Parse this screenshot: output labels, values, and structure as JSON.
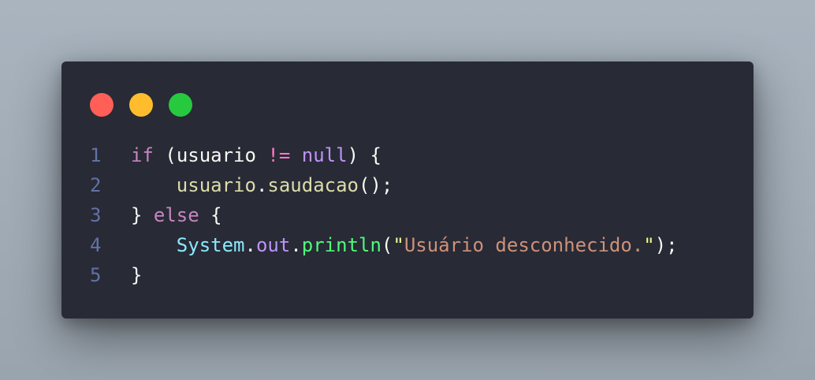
{
  "window": {
    "controls": [
      {
        "name": "close",
        "color": "#ff5f56"
      },
      {
        "name": "minimize",
        "color": "#ffbd2e"
      },
      {
        "name": "maximize",
        "color": "#27c93f"
      }
    ]
  },
  "colors": {
    "keyword": "#c586c0",
    "operator": "#ff79c6",
    "null": "#bd93f9",
    "default": "#f8f8f2",
    "method": "#dcdcaa",
    "class": "#8be9fd",
    "field": "#bd93f9",
    "call": "#50fa7b",
    "string": "#ce9178",
    "quote": "#f1fa8c",
    "line_number": "#6272a4"
  },
  "code": {
    "line_numbers": [
      "1",
      "2",
      "3",
      "4",
      "5"
    ],
    "lines": [
      {
        "tokens": [
          {
            "text": "if",
            "kind": "keyword"
          },
          {
            "text": " (",
            "kind": "default"
          },
          {
            "text": "usuario",
            "kind": "default"
          },
          {
            "text": " ",
            "kind": "default"
          },
          {
            "text": "!=",
            "kind": "operator"
          },
          {
            "text": " ",
            "kind": "default"
          },
          {
            "text": "null",
            "kind": "null"
          },
          {
            "text": ") {",
            "kind": "default"
          }
        ]
      },
      {
        "tokens": [
          {
            "text": "    ",
            "kind": "default"
          },
          {
            "text": "usuario",
            "kind": "method"
          },
          {
            "text": ".",
            "kind": "default"
          },
          {
            "text": "saudacao",
            "kind": "method"
          },
          {
            "text": "();",
            "kind": "default"
          }
        ]
      },
      {
        "tokens": [
          {
            "text": "} ",
            "kind": "default"
          },
          {
            "text": "else",
            "kind": "keyword"
          },
          {
            "text": " {",
            "kind": "default"
          }
        ]
      },
      {
        "tokens": [
          {
            "text": "    ",
            "kind": "default"
          },
          {
            "text": "System",
            "kind": "class"
          },
          {
            "text": ".",
            "kind": "default"
          },
          {
            "text": "out",
            "kind": "field"
          },
          {
            "text": ".",
            "kind": "default"
          },
          {
            "text": "println",
            "kind": "call"
          },
          {
            "text": "(",
            "kind": "default"
          },
          {
            "text": "\"",
            "kind": "quote"
          },
          {
            "text": "Usuário desconhecido.",
            "kind": "string"
          },
          {
            "text": "\"",
            "kind": "quote"
          },
          {
            "text": ");",
            "kind": "default"
          }
        ]
      },
      {
        "tokens": [
          {
            "text": "}",
            "kind": "default"
          }
        ]
      }
    ]
  }
}
